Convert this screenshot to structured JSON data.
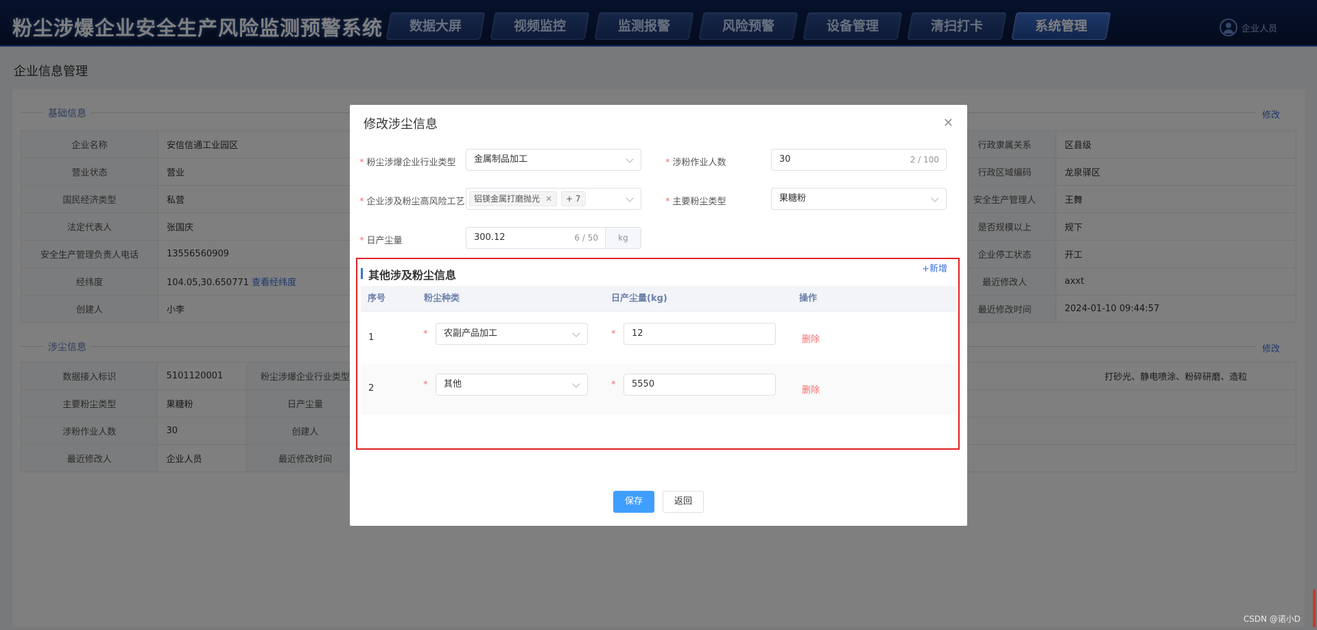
{
  "header": {
    "title": "粉尘涉爆企业安全生产风险监测预警系统",
    "nav": [
      "数据大屏",
      "视频监控",
      "监测报警",
      "风险预警",
      "设备管理",
      "清扫打卡",
      "系统管理"
    ],
    "active_nav": "系统管理",
    "user": "企业人员"
  },
  "page": {
    "title": "企业信息管理",
    "basic_section": "基础信息",
    "dust_section": "涉尘信息",
    "edit_label": "修改"
  },
  "basic_info": {
    "left": [
      {
        "k": "企业名称",
        "v": "安信信通工业园区"
      },
      {
        "k": "营业状态",
        "v": "营业"
      },
      {
        "k": "国民经济类型",
        "v": "私营"
      },
      {
        "k": "法定代表人",
        "v": "张国庆"
      },
      {
        "k": "安全生产管理负责人电话",
        "v": "13556560909"
      },
      {
        "k": "经纬度",
        "v": "104.05,30.650771",
        "link": "查看经纬度"
      },
      {
        "k": "创建人",
        "v": "小李"
      }
    ],
    "right": [
      {
        "k": "行政隶属关系",
        "v": "区县级"
      },
      {
        "k": "行政区域编码",
        "v": "龙泉驿区"
      },
      {
        "k": "安全生产管理人",
        "v": "王舞"
      },
      {
        "k": "是否规模以上",
        "v": "规下"
      },
      {
        "k": "企业停工状态",
        "v": "开工"
      },
      {
        "k": "最近修改人",
        "v": "axxt"
      },
      {
        "k": "最近修改时间",
        "v": "2024-01-10 09:44:57"
      }
    ]
  },
  "dust_info": {
    "rows": [
      {
        "k1": "数据接入标识",
        "v1": "5101120001",
        "k2": "粉尘涉爆企业行业类型"
      },
      {
        "k1": "主要粉尘类型",
        "v1": "果糖粉",
        "k2": "日产尘量"
      },
      {
        "k1": "涉粉作业人数",
        "v1": "30",
        "k2": "创建人"
      },
      {
        "k1": "最近修改人",
        "v1": "企业人员",
        "k2": "最近修改时间"
      }
    ],
    "right_text": "打砂光、静电喷涂、粉碎研磨、造粒"
  },
  "modal": {
    "title": "修改涉尘信息",
    "industry_label": "粉尘涉爆企业行业类型",
    "industry_value": "金属制品加工",
    "workers_label": "涉粉作业人数",
    "workers_value": "30",
    "workers_count": "2 / 100",
    "process_label": "企业涉及粉尘高风险工艺",
    "process_tag": "铝镁金属打磨抛光",
    "process_more": "+ 7",
    "dust_type_label": "主要粉尘类型",
    "dust_type_value": "果糖粉",
    "daily_label": "日产尘量",
    "daily_value": "300.12",
    "daily_count": "6 / 50",
    "daily_unit": "kg",
    "other_title": "其他涉及粉尘信息",
    "add_label": "+新增",
    "columns": [
      "序号",
      "粉尘种类",
      "日产尘量(kg)",
      "操作"
    ],
    "rows": [
      {
        "no": "1",
        "type": "农副产品加工",
        "amount": "12",
        "action": "删除"
      },
      {
        "no": "2",
        "type": "其他",
        "amount": "5550",
        "action": "删除"
      }
    ],
    "save_label": "保存",
    "back_label": "返回"
  },
  "watermark": "CSDN @诺小D"
}
